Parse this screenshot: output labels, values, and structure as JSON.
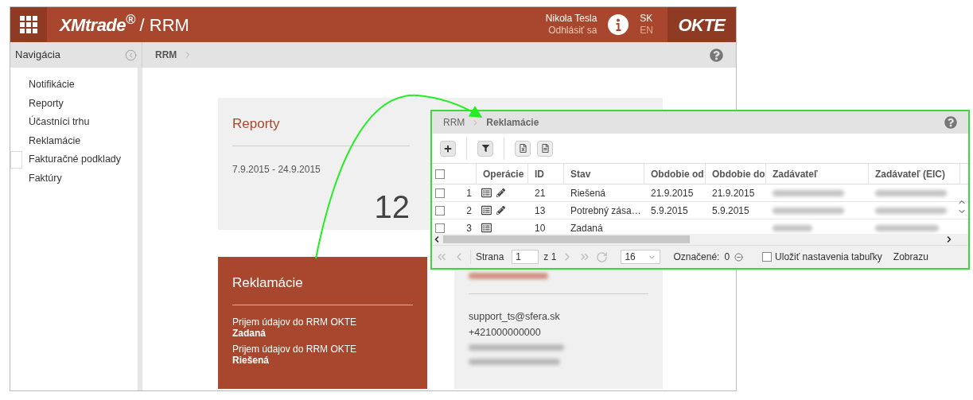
{
  "header": {
    "logo": "XMtrade$^{®}$",
    "app_title": "/ RRM",
    "user_name": "Nikola Tesla",
    "logout": "Odhlásiť sa",
    "languages": [
      {
        "label": "SK",
        "selected": true
      },
      {
        "label": "EN",
        "selected": false
      }
    ],
    "brand": "OKTE"
  },
  "navigation": {
    "title": "Navigácia",
    "items": [
      {
        "label": "Notifikácie",
        "selected": false
      },
      {
        "label": "Reporty",
        "selected": false
      },
      {
        "label": "Účastníci trhu",
        "selected": false
      },
      {
        "label": "Reklamácie",
        "selected": false
      },
      {
        "label": "Fakturačné podklady",
        "selected": true
      },
      {
        "label": "Faktúry",
        "selected": false
      }
    ]
  },
  "breadcrumb": [
    "RRM"
  ],
  "reports_card": {
    "title": "Reporty",
    "period": "7.9.2015 - 24.9.2015",
    "count": "12"
  },
  "claims_card": {
    "title": "Reklamácie",
    "entries": [
      {
        "text": "Prijem údajov do RRM OKTE",
        "status": "Zadaná"
      },
      {
        "text": "Prijem údajov do RRM OKTE",
        "status": "Riešená"
      }
    ]
  },
  "contact_card": {
    "email": "support_ts@sfera.sk",
    "phone": "+421000000000"
  },
  "overlay": {
    "breadcrumb": [
      "RRM",
      "Reklamácie"
    ],
    "select_all": {
      "checked": false
    },
    "columns": [
      "Operácie",
      "ID",
      "Stav",
      "Obdobie od",
      "Obdobie do",
      "Zadávateľ",
      "Zadávateľ (EIC)"
    ],
    "rows": [
      {
        "number": "1",
        "checked": false,
        "editable": true,
        "id": "21",
        "status": "Riešená",
        "from": "21.9.2015",
        "to": "21.9.2015"
      },
      {
        "number": "2",
        "checked": false,
        "editable": true,
        "id": "13",
        "status": "Potrebný zása…",
        "from": "5.9.2015",
        "to": "5.9.2015"
      },
      {
        "number": "3",
        "checked": false,
        "editable": false,
        "id": "10",
        "status": "Zadaná",
        "from": "",
        "to": ""
      }
    ],
    "pager": {
      "page_label": "Strana",
      "page": "1",
      "of": "z 1",
      "page_size": "16",
      "marked_label": "Označené:",
      "marked": "0",
      "save_settings": {
        "label": "Uložiť nastavenia tabuľky",
        "checked": false
      },
      "show_label": "Zobrazu"
    }
  }
}
